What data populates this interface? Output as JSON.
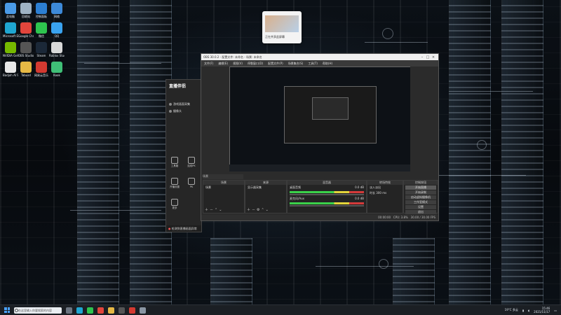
{
  "desktop": {
    "icons": [
      {
        "label": "此电脑",
        "icon": "computer-icon",
        "color": "#4a9be8"
      },
      {
        "label": "回收站",
        "icon": "recycle-bin-icon",
        "color": "#9fb3c4"
      },
      {
        "label": "控制面板",
        "icon": "control-panel-icon",
        "color": "#2c7fd3"
      },
      {
        "label": "网络",
        "icon": "network-icon",
        "color": "#3d8ad9"
      },
      {
        "label": "Microsoft Edge",
        "icon": "edge-icon",
        "color": "#1fa6d1"
      },
      {
        "label": "Google Chrome",
        "icon": "chrome-icon",
        "color": "#e2453c"
      },
      {
        "label": "微信",
        "icon": "wechat-icon",
        "color": "#2ec44f"
      },
      {
        "label": "QQ",
        "icon": "qq-icon",
        "color": "#3aa3f0"
      },
      {
        "label": "NVIDIA GeForce Experience",
        "icon": "nvidia-icon",
        "color": "#76b900"
      },
      {
        "label": "OBS Studio",
        "icon": "obs-icon",
        "color": "#555555"
      },
      {
        "label": "Steam",
        "icon": "steam-icon",
        "color": "#1b2838"
      },
      {
        "label": "Roblox Studio",
        "icon": "roblox-icon",
        "color": "#d9d9d9"
      },
      {
        "label": "Badjoh AI Softwares",
        "icon": "ai-icon",
        "color": "#e8e8e8"
      },
      {
        "label": "Tabusd",
        "icon": "folder-icon",
        "color": "#e6b845"
      },
      {
        "label": "网易云音乐",
        "icon": "music-icon",
        "color": "#d33a31"
      },
      {
        "label": "Kook",
        "icon": "kook-icon",
        "color": "#3fbf77"
      }
    ]
  },
  "notification": {
    "text": "正在共享此屏幕"
  },
  "obs": {
    "title": "OBS 30.0.2 - 配置文件: 未命名 - 场景: 未命名",
    "menu": [
      "文件(F)",
      "编辑(E)",
      "视图(V)",
      "停靠窗口(D)",
      "配置文件(P)",
      "场景集合(S)",
      "工具(T)",
      "帮助(H)"
    ],
    "docks": {
      "scenes_label": "场景",
      "sources_label": "来源",
      "mixer_label": "混音器",
      "transitions_label": "转场特效",
      "controls_label": "控制按钮"
    },
    "scenes": [
      "场景"
    ],
    "sources": [
      "显示器采集"
    ],
    "mixer": [
      {
        "name": "桌面音频",
        "level": "0.0 dB"
      },
      {
        "name": "麦克风/Aux",
        "level": "0.0 dB"
      }
    ],
    "transition": {
      "type": "淡入淡出",
      "duration_label": "时长",
      "duration": "300 ms"
    },
    "controls": [
      "开始直播",
      "开始录制",
      "启动虚拟摄像机",
      "工作室模式",
      "设置",
      "退出"
    ],
    "status": {
      "fps": "30.00 / 30.00 FPS",
      "cpu": "CPU: 3.8%",
      "time": "00:00:00"
    }
  },
  "side_app": {
    "logo": "直播伴侣",
    "items": [
      "游戏画面采集",
      "摄像头"
    ],
    "tiles": [
      "工具箱",
      "连线PK",
      "开播设置",
      "PK",
      "更多"
    ],
    "bottom": "检测到直播画面异常"
  },
  "taskbar": {
    "search_placeholder": "在这里输入你要搜索的内容",
    "apps": [
      "task-view-icon",
      "edge-icon",
      "wechat-icon",
      "chrome-icon",
      "file-explorer-icon",
      "obs-icon",
      "music-icon",
      "settings-icon"
    ],
    "tray": {
      "weather": "19°C",
      "weather_desc": "多云",
      "time": "15:46",
      "date": "2021/11/17"
    }
  }
}
